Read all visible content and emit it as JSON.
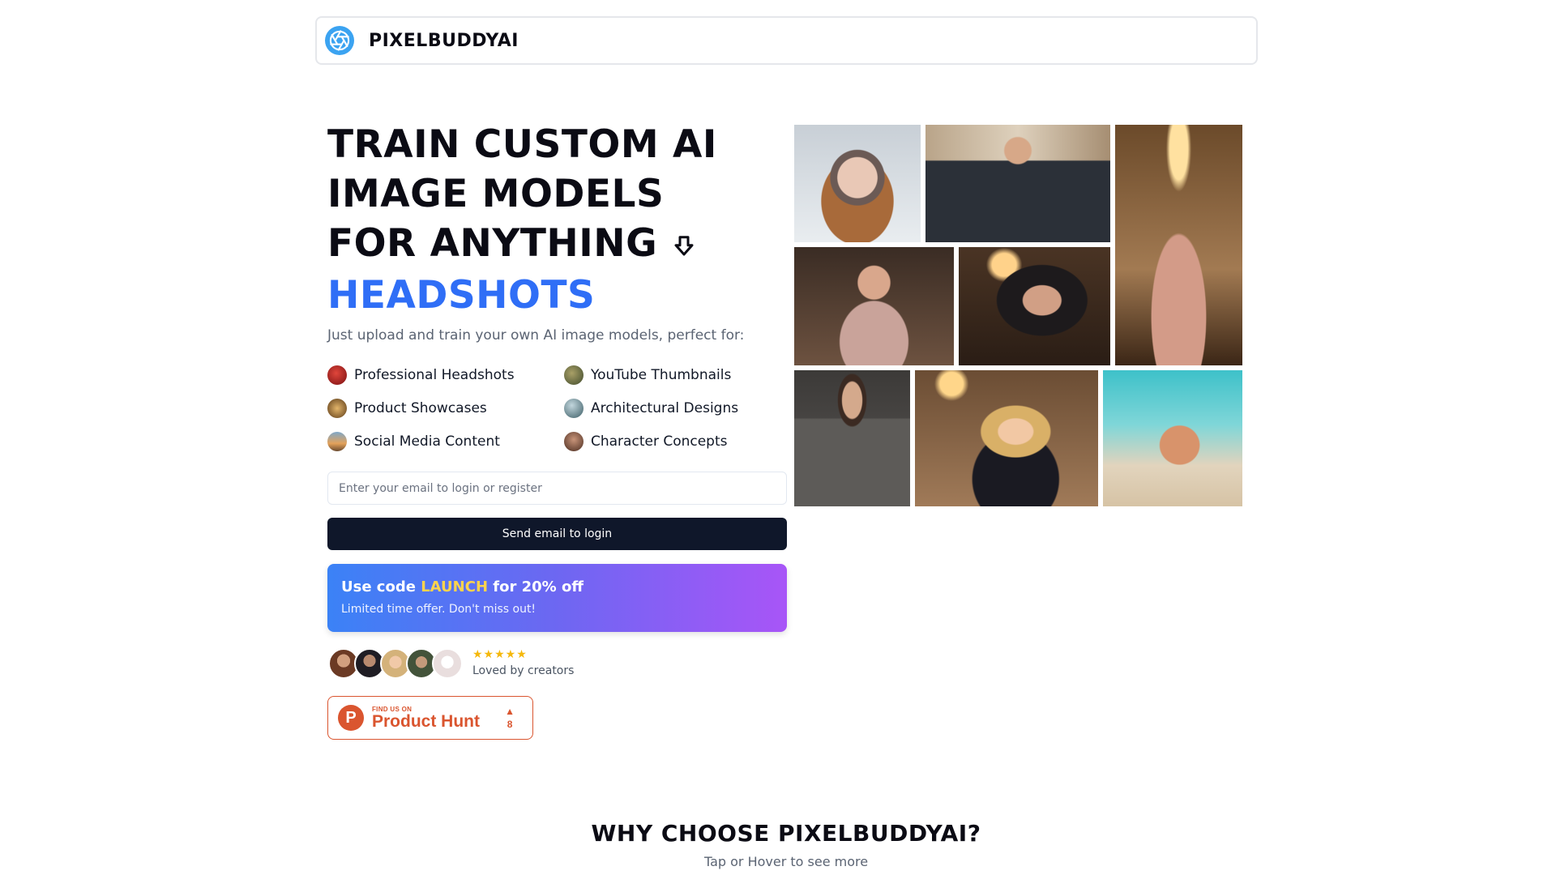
{
  "brand": {
    "name": "PIXELBUDDYAI",
    "accent_color": "#2f6ef6"
  },
  "hero": {
    "headline_lines": [
      "TRAIN CUSTOM AI",
      "IMAGE MODELS",
      "FOR ANYTHING"
    ],
    "headline_accent": "HEADSHOTS",
    "subtitle": "Just upload and train your own AI image models, perfect for:"
  },
  "features": [
    {
      "label": "Professional Headshots",
      "icon": "portrait-thumb-icon"
    },
    {
      "label": "YouTube Thumbnails",
      "icon": "thumbnail-thumb-icon"
    },
    {
      "label": "Product Showcases",
      "icon": "product-thumb-icon"
    },
    {
      "label": "Architectural Designs",
      "icon": "architecture-thumb-icon"
    },
    {
      "label": "Social Media Content",
      "icon": "social-thumb-icon"
    },
    {
      "label": "Character Concepts",
      "icon": "character-thumb-icon"
    }
  ],
  "login": {
    "email_placeholder": "Enter your email to login or register",
    "email_value": "",
    "submit_label": "Send email to login"
  },
  "promo": {
    "prefix": "Use code ",
    "code": "LAUNCH",
    "suffix": " for 20% off",
    "subtitle": "Limited time offer. Don't miss out!"
  },
  "social_proof": {
    "stars": "★★★★★",
    "label": "Loved by creators"
  },
  "product_hunt": {
    "small": "FIND US ON",
    "big": "Product Hunt",
    "logo_letter": "P",
    "vote_arrow": "▲",
    "votes": "8"
  },
  "why": {
    "title": "WHY CHOOSE PIXELBUDDYAI?",
    "subtitle": "Tap or Hover to see more"
  }
}
